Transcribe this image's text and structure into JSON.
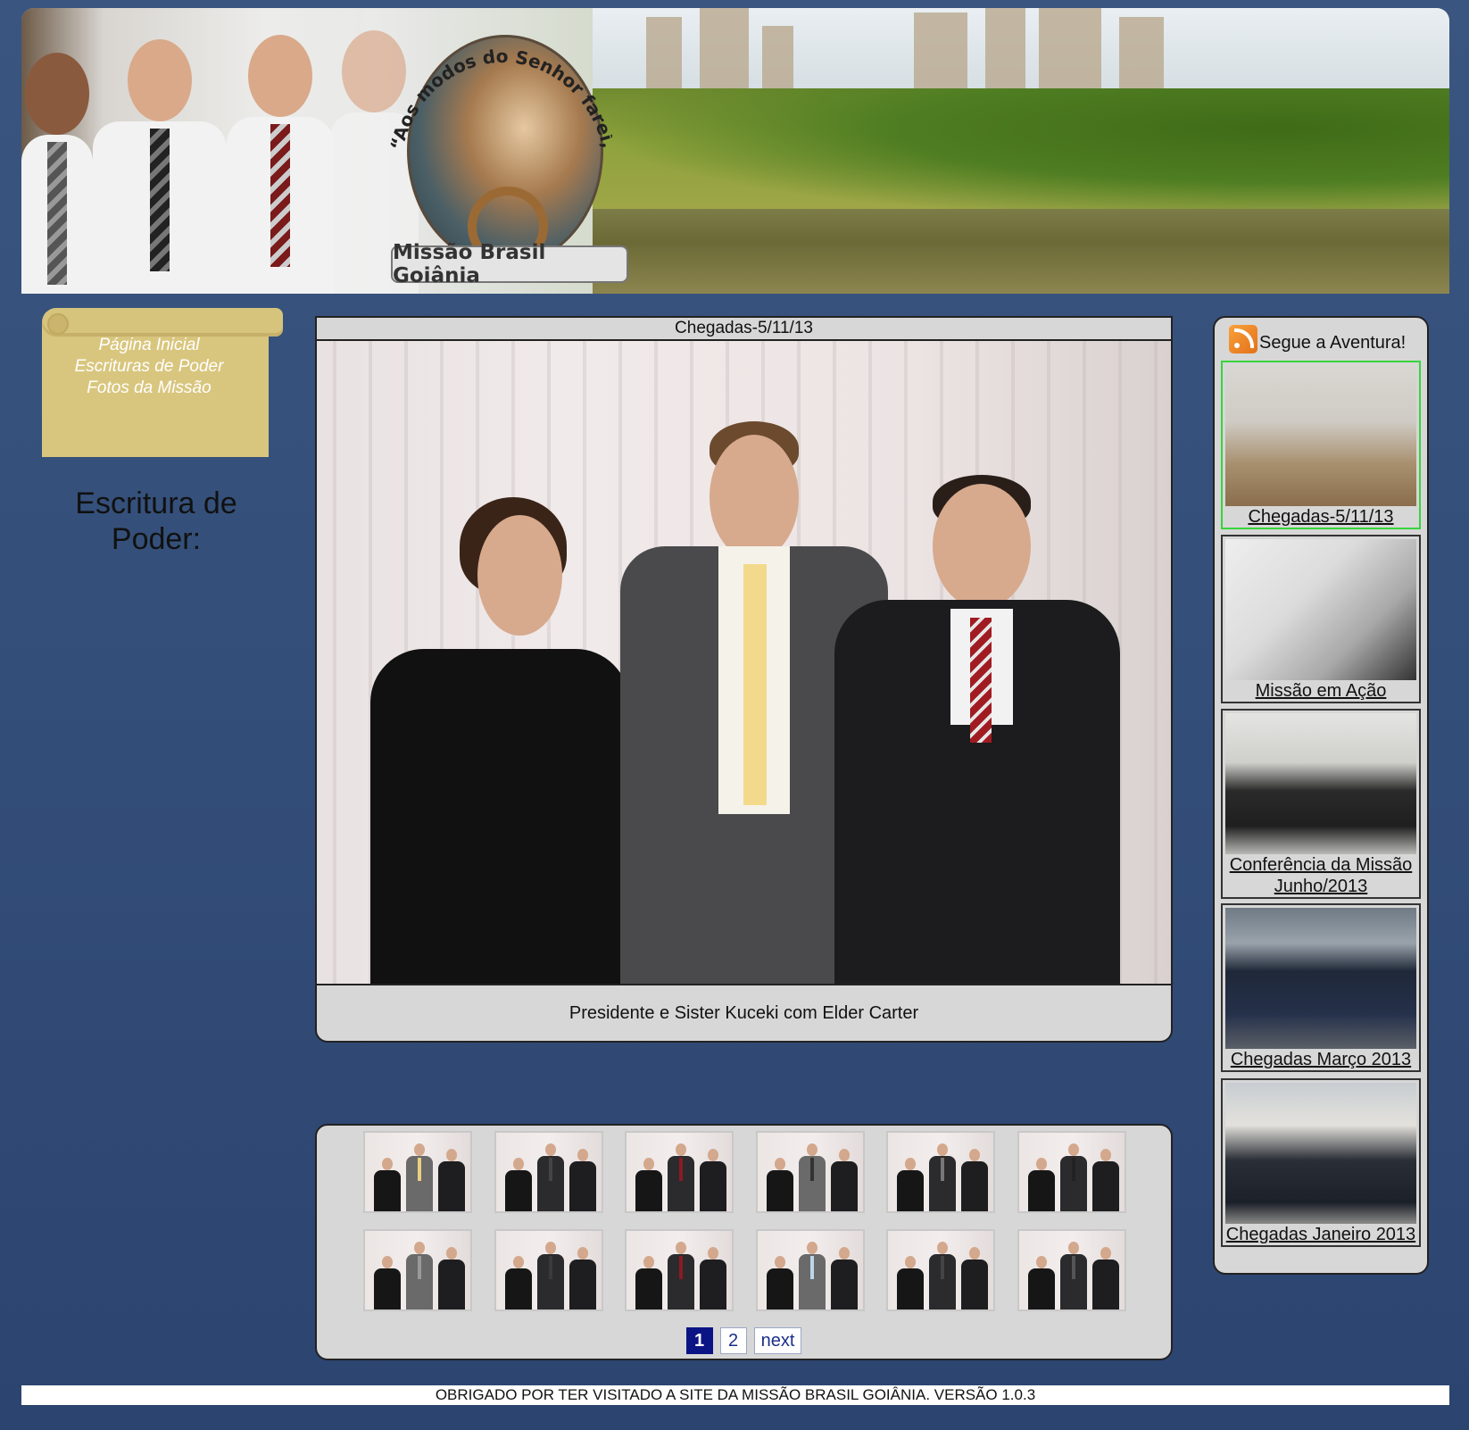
{
  "banner": {
    "title": "Missão Brasil Goiânia",
    "motto": "“Aos modos do Senhor farei, e os milagres vem.”"
  },
  "nav": {
    "items": [
      {
        "label": "Página Inicial"
      },
      {
        "label": "Escrituras de Poder"
      },
      {
        "label": "Fotos da Missão"
      }
    ]
  },
  "scripture": {
    "title": "Escritura de Poder:"
  },
  "main": {
    "album_title": "Chegadas-5/11/13",
    "photo_caption": "Presidente e Sister Kuceki com Elder Carter"
  },
  "thumbnails": {
    "count": 12,
    "pager": {
      "pages": [
        "1",
        "2"
      ],
      "current": "1",
      "next_label": "next"
    }
  },
  "sidebar": {
    "heading": "Segue a Aventura!",
    "albums": [
      {
        "label": "Chegadas-5/11/13",
        "selected": true
      },
      {
        "label": "Missão em Ação",
        "selected": false
      },
      {
        "label": "Conferência da Missão Junho/2013",
        "selected": false
      },
      {
        "label": "Chegadas Março 2013",
        "selected": false
      },
      {
        "label": "Chegadas Janeiro 2013",
        "selected": false
      }
    ]
  },
  "footer": {
    "text": "OBRIGADO POR TER VISITADO A SITE DA MISSÃO BRASIL GOIÂNIA. VERSÃO 1.0.3"
  },
  "colors": {
    "background": "#34507a",
    "scroll": "#d9c67e",
    "panel": "#d7d7d7",
    "pager_active": "#0a1484",
    "selected_border": "#37d43c"
  }
}
